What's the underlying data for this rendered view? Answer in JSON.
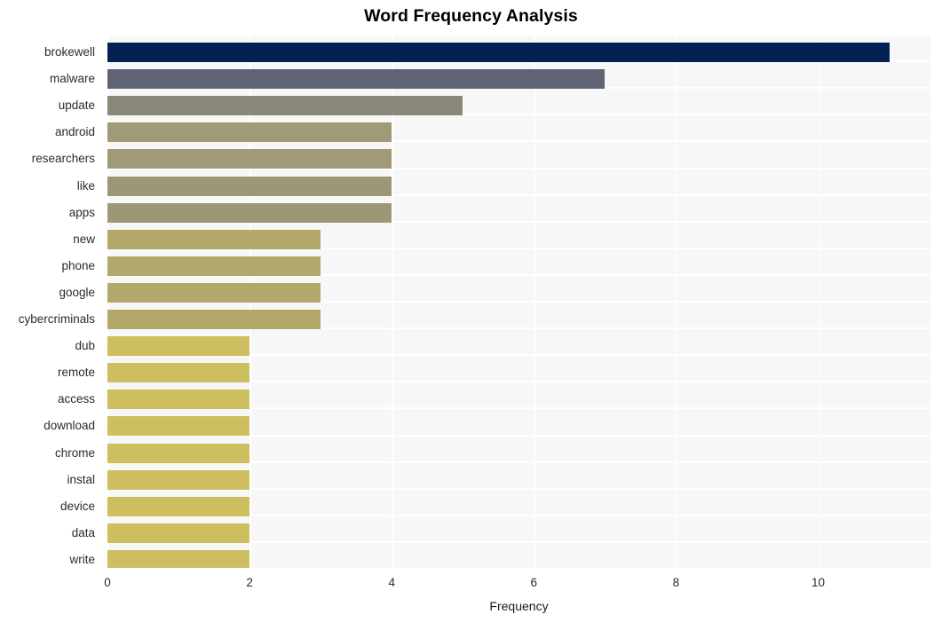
{
  "chart_data": {
    "type": "bar",
    "orientation": "horizontal",
    "title": "Word Frequency Analysis",
    "xlabel": "Frequency",
    "ylabel": "",
    "xlim": [
      0,
      11.58
    ],
    "xticks": [
      0,
      2,
      4,
      6,
      8,
      10
    ],
    "xticklabels": [
      "0",
      "2",
      "4",
      "6",
      "8",
      "10"
    ],
    "grid": true,
    "grid_color": "#ffffff",
    "panel_color": "#f7f7f7",
    "legend": null,
    "categories": [
      "brokewell",
      "malware",
      "update",
      "android",
      "researchers",
      "like",
      "apps",
      "new",
      "phone",
      "google",
      "cybercriminals",
      "dub",
      "remote",
      "access",
      "download",
      "chrome",
      "instal",
      "device",
      "data",
      "write"
    ],
    "values": [
      11,
      7,
      5,
      4,
      4,
      4,
      4,
      3,
      3,
      3,
      3,
      2,
      2,
      2,
      2,
      2,
      2,
      2,
      2,
      2
    ],
    "bar_colors": [
      "#032254",
      "#5f6374",
      "#8a8878",
      "#a09a77",
      "#a09a77",
      "#9d9775",
      "#9d9775",
      "#b3a86b",
      "#b3a86b",
      "#b3a86b",
      "#b3a86b",
      "#cdbe5f",
      "#cdbe5f",
      "#cdbe5f",
      "#cdbe5f",
      "#cdbe5f",
      "#cdbe5f",
      "#cdbe5f",
      "#cdbe5f",
      "#cdbe5f"
    ]
  }
}
